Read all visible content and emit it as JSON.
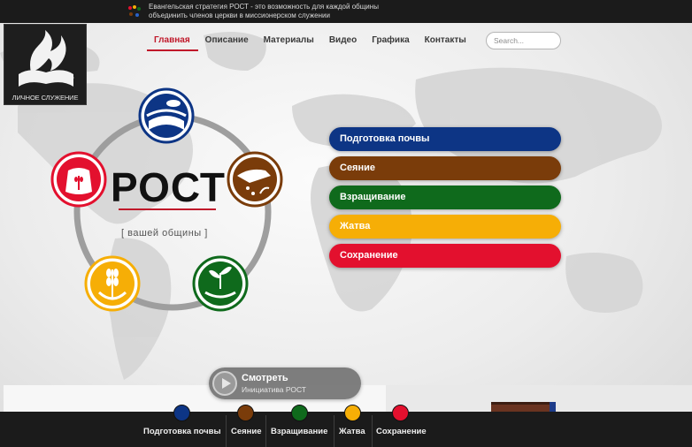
{
  "topbar": {
    "line1": "Евангельская стратегия РОСТ - это возможность для каждой общины",
    "line2": "объединить членов церкви в миссионерском служении"
  },
  "logo": {
    "caption": "ЛИЧНОЕ СЛУЖЕНИЕ"
  },
  "nav": {
    "items": [
      {
        "label": "Главная",
        "active": true
      },
      {
        "label": "Описание"
      },
      {
        "label": "Материалы"
      },
      {
        "label": "Видео"
      },
      {
        "label": "Графика"
      },
      {
        "label": "Контакты"
      }
    ]
  },
  "search": {
    "placeholder": "Search..."
  },
  "brand": {
    "title": "РОСТ",
    "tagline": "[ вашей общины ]"
  },
  "stages": [
    {
      "label": "Подготовка почвы",
      "color": "#0d3585"
    },
    {
      "label": "Сеяние",
      "color": "#7a3c0a"
    },
    {
      "label": "Взращивание",
      "color": "#0f6a1c"
    },
    {
      "label": "Жатва",
      "color": "#f6ae06"
    },
    {
      "label": "Сохранение",
      "color": "#e3102e"
    }
  ],
  "cycle_icons": [
    {
      "name": "soil-field-icon",
      "color": "#0d3585"
    },
    {
      "name": "sowing-hand-icon",
      "color": "#7a3c0a"
    },
    {
      "name": "sprout-hand-icon",
      "color": "#0f6a1c"
    },
    {
      "name": "wheat-harvest-icon",
      "color": "#f6ae06"
    },
    {
      "name": "grain-sack-icon",
      "color": "#e3102e"
    }
  ],
  "watch": {
    "title": "Смотреть",
    "subtitle": "Инициатива РОСТ"
  },
  "bottom_nav": [
    {
      "label": "Подготовка почвы",
      "color": "#0d3585"
    },
    {
      "label": "Сеяние",
      "color": "#7a3c0a"
    },
    {
      "label": "Взращивание",
      "color": "#0f6a1c"
    },
    {
      "label": "Жатва",
      "color": "#f6ae06"
    },
    {
      "label": "Сохранение",
      "color": "#e3102e"
    }
  ]
}
